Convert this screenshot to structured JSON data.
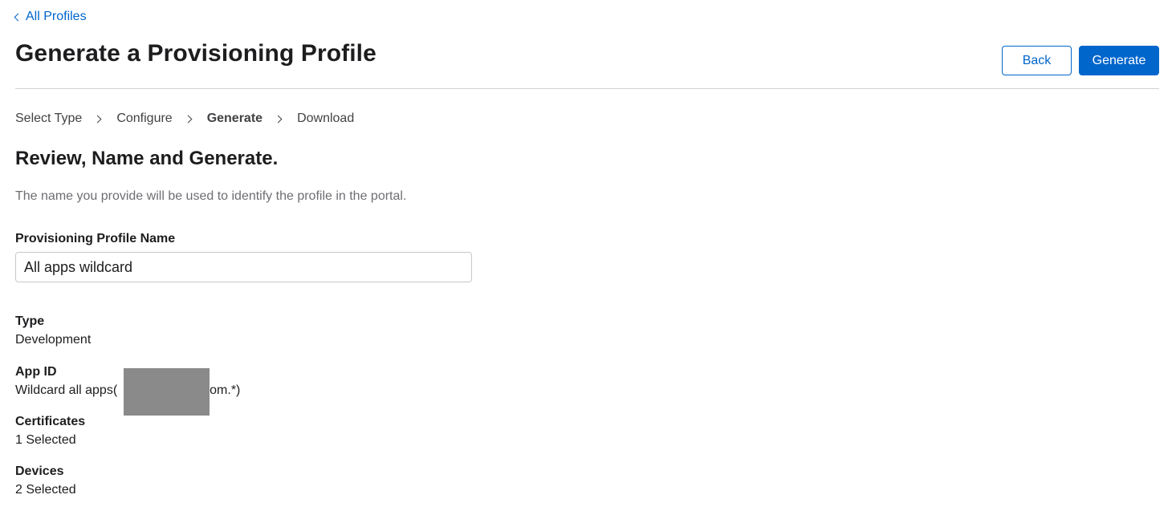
{
  "nav": {
    "back_link_label": "All Profiles"
  },
  "header": {
    "title": "Generate a Provisioning Profile",
    "back_button_label": "Back",
    "generate_button_label": "Generate"
  },
  "steps": [
    "Select Type",
    "Configure",
    "Generate",
    "Download"
  ],
  "active_step": "Generate",
  "section": {
    "title": "Review, Name and Generate.",
    "description": "The name you provide will be used to identify the profile in the portal."
  },
  "form": {
    "name_label": "Provisioning Profile Name",
    "name_value": "All apps wildcard"
  },
  "details": {
    "type_label": "Type",
    "type_value": "Development",
    "app_id_label": "App ID",
    "app_id_prefix": "Wildcard all apps(",
    "app_id_suffix": "com.*)",
    "certificates_label": "Certificates",
    "certificates_value": "1 Selected",
    "devices_label": "Devices",
    "devices_value": "2 Selected"
  },
  "colors": {
    "accent": "#0066cc",
    "title": "#1d1d1f",
    "muted": "#6e6e73",
    "redaction": "#8a8a8a"
  }
}
